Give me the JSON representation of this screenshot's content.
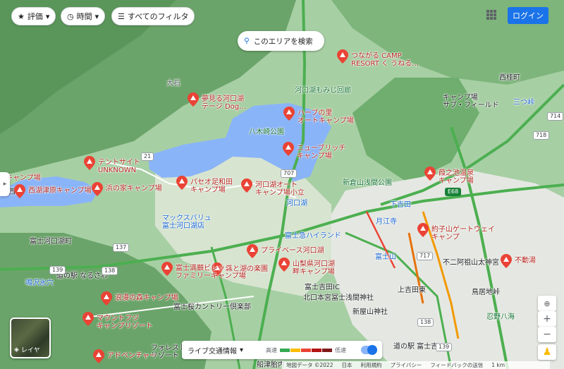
{
  "toolbar": {
    "rating_label": "評価",
    "time_label": "時間",
    "filters_label": "すべてのフィルタ",
    "login_label": "ログイン"
  },
  "search_area_label": "このエリアを検索",
  "places": [
    {
      "name": "つながる CAMP\nRESORT く うねる…",
      "color": "red"
    },
    {
      "name": "西桂町",
      "color": "dark"
    },
    {
      "name": "夢見る河口湖\nテージ Dog…",
      "color": "red"
    },
    {
      "name": "河口湖もみじ回廊",
      "color": "green"
    },
    {
      "name": "キャンプ場\nサブ・フィールド",
      "color": "dark"
    },
    {
      "name": "三つ峠",
      "color": "blue"
    },
    {
      "name": "ハーブの里\nオートキャンプ場",
      "color": "red"
    },
    {
      "name": "八木崎公園",
      "color": "green"
    },
    {
      "name": "テントサイト\nUNKNOWN",
      "color": "red"
    },
    {
      "name": "ニューブリッチ\nキャンプ場",
      "color": "red"
    },
    {
      "name": "キャンプ場",
      "color": "red"
    },
    {
      "name": "西湖",
      "color": "dark"
    },
    {
      "name": "西湖津原キャンプ場",
      "color": "red"
    },
    {
      "name": "浜の家キャンプ場",
      "color": "red"
    },
    {
      "name": "パセオ足和田\nキャンプ場",
      "color": "red"
    },
    {
      "name": "河口湖オート\nキャンプ場小立",
      "color": "red"
    },
    {
      "name": "新倉山浅間公園",
      "color": "green"
    },
    {
      "name": "葭之池温泉\nキャンプ場",
      "color": "red"
    },
    {
      "name": "河口湖",
      "color": "blue"
    },
    {
      "name": "下吉田",
      "color": "blue"
    },
    {
      "name": "マックスバリュ\n富士河口湖店",
      "color": "blue"
    },
    {
      "name": "月江寺",
      "color": "blue"
    },
    {
      "name": "約子山ゲートウェイ\nキャンプ",
      "color": "red"
    },
    {
      "name": "富士急ハイランド",
      "color": "blue"
    },
    {
      "name": "富士河口湖町",
      "color": "dark"
    },
    {
      "name": "プライベース河口湖",
      "color": "red"
    },
    {
      "name": "富士山",
      "color": "blue"
    },
    {
      "name": "不二阿祖山太神宮",
      "color": "dark"
    },
    {
      "name": "不動湯",
      "color": "red"
    },
    {
      "name": "道の駅 なるさわ",
      "color": "dark"
    },
    {
      "name": "森と湖の楽園",
      "color": "red"
    },
    {
      "name": "山梨県河口湖\n畔キャンプ場",
      "color": "red"
    },
    {
      "name": "富士満願ビレッジ\nファミリーキャンプ場",
      "color": "red"
    },
    {
      "name": "鳴沢氷穴",
      "color": "blue"
    },
    {
      "name": "浪漫の森キャンプ場",
      "color": "red"
    },
    {
      "name": "富士吉田IC",
      "color": "dark"
    },
    {
      "name": "北口本宮冨士浅間神社",
      "color": "dark"
    },
    {
      "name": "上吉田東",
      "color": "dark"
    },
    {
      "name": "鳥居地峠",
      "color": "dark"
    },
    {
      "name": "富士桜カントリー倶楽部",
      "color": "dark"
    },
    {
      "name": "新屋山神社",
      "color": "dark"
    },
    {
      "name": "マウントフジ\nキャンプリゾート",
      "color": "red"
    },
    {
      "name": "忍野八海",
      "color": "green"
    },
    {
      "name": "フォレスト\nリゾート",
      "color": "dark"
    },
    {
      "name": "アドベンチャー",
      "color": "red"
    },
    {
      "name": "道の駅 富士吉田",
      "color": "dark"
    },
    {
      "name": "大石",
      "color": "gray"
    },
    {
      "name": "船津胎内",
      "color": "dark"
    }
  ],
  "roads": [
    "139",
    "707",
    "714",
    "21",
    "718",
    "137",
    "717",
    "E68",
    "138",
    "139",
    "138"
  ],
  "layers": {
    "label": "レイヤ"
  },
  "traffic": {
    "label": "ライブ交通情報",
    "fast": "高速",
    "slow": "低速",
    "colors": [
      "#34a853",
      "#fbbc04",
      "#ea4335",
      "#b31412",
      "#7f1a1a"
    ]
  },
  "footer": {
    "map_data": "地図データ ©2022",
    "country": "日本",
    "terms": "利用規約",
    "privacy": "プライバシー",
    "feedback": "フィードバックの送信",
    "scale": "1 km"
  },
  "colors": {
    "water": "#8ab4f8",
    "forest": "#6ca66c",
    "terrain": "#94c794",
    "urban": "#dfe3dc",
    "road": "#57bb5a",
    "pin": "#ea4335"
  }
}
